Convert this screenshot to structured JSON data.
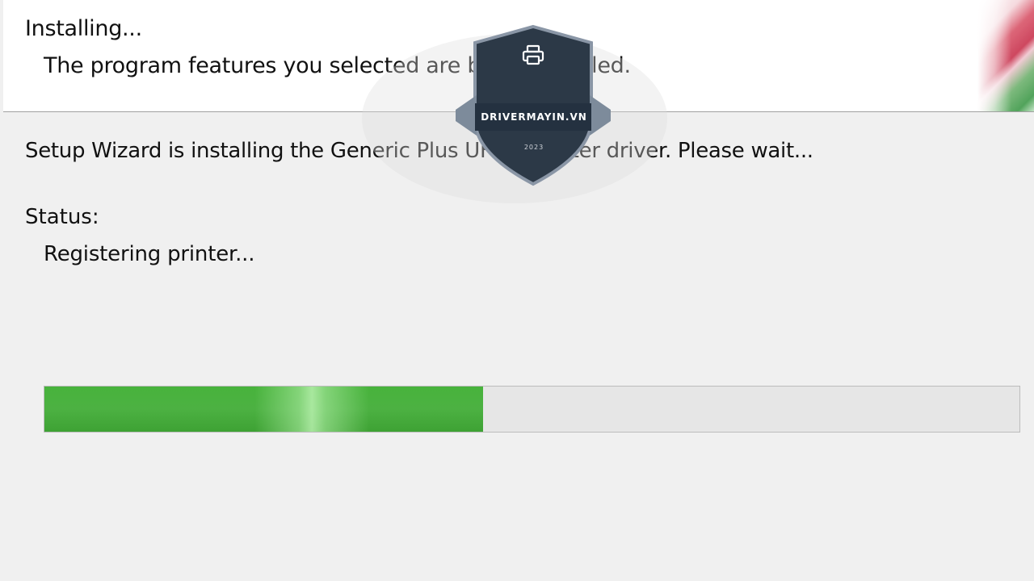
{
  "header": {
    "title": "Installing...",
    "subtitle": "The program features you selected are being installed."
  },
  "main": {
    "description": "Setup Wizard is installing the Generic Plus UFR II printer driver. Please wait...",
    "status_label": "Status:",
    "status_value": "Registering printer..."
  },
  "progress": {
    "fraction": 0.45,
    "fill_color": "#4caf3f"
  },
  "watermark": {
    "icon": "printer-icon",
    "brand": "DRIVERMAYIN.VN",
    "year": "2023"
  }
}
